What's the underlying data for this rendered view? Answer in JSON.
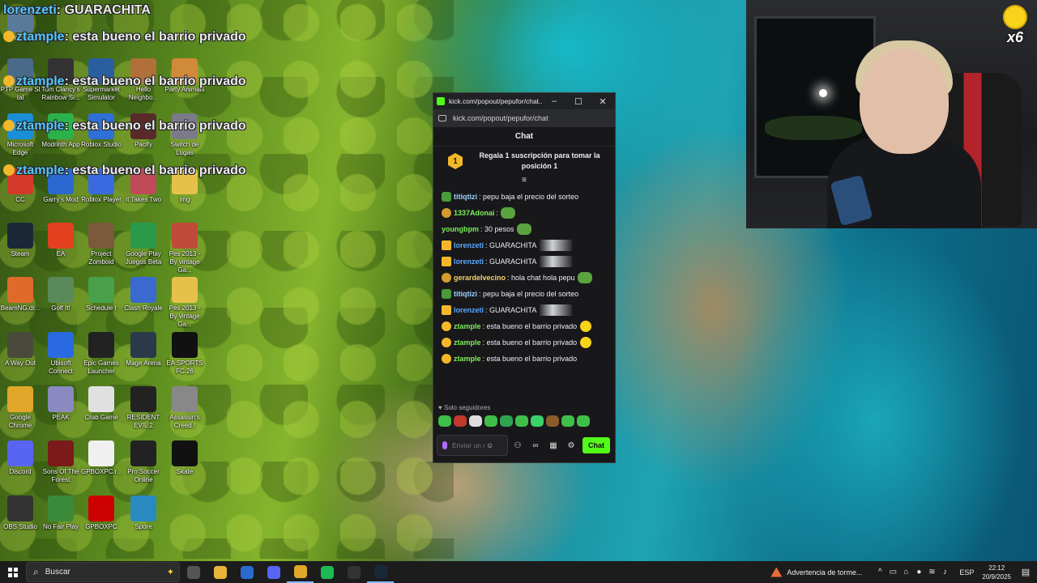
{
  "overlay": {
    "top_name": "lorenzeti",
    "top_text": "GUARACHITA",
    "lines": [
      {
        "user": "ztample",
        "text": "esta bueno el barrio privado"
      },
      {
        "user": "ztample",
        "text": "esta bueno el barrio privado"
      },
      {
        "user": "ztample",
        "text": "esta bueno el barrio privado"
      },
      {
        "user": "ztample",
        "text": "esta bueno el barrio privado"
      }
    ]
  },
  "desktop_icons": [
    {
      "label": "reciclaje",
      "color": "#5a7a9a"
    },
    {
      "label": "PTP Game Sl tal",
      "color": "#4a6a8a"
    },
    {
      "label": "Tom Clancy's Rainbow Si...",
      "color": "#333"
    },
    {
      "label": "Supermarket Simulator",
      "color": "#2a5ea0"
    },
    {
      "label": "Hello Neighbo...",
      "color": "#b0703a"
    },
    {
      "label": "Party Animals",
      "color": "#d08a3a"
    },
    {
      "label": "Microsoft Edge",
      "color": "#1a8fd6"
    },
    {
      "label": "Modrinth App",
      "color": "#2bb34b"
    },
    {
      "label": "Roblox Studio",
      "color": "#2e6fd8"
    },
    {
      "label": "Pacify",
      "color": "#5a2a2a"
    },
    {
      "label": "Switch de Lugas",
      "color": "#7a7a8a"
    },
    {
      "label": "CC",
      "color": "#d43a2a"
    },
    {
      "label": "Garry's Mod",
      "color": "#2a6ad0"
    },
    {
      "label": "Roblox Player",
      "color": "#3a6ae0"
    },
    {
      "label": "It Takes Two",
      "color": "#c04a5a"
    },
    {
      "label": "img",
      "color": "#e6c14a"
    },
    {
      "label": "Steam",
      "color": "#1b2838"
    },
    {
      "label": "EA",
      "color": "#e2401f"
    },
    {
      "label": "Project Zomboid",
      "color": "#7a5a3a"
    },
    {
      "label": "Google Play Juegos Beta",
      "color": "#2a9a4a"
    },
    {
      "label": "Pes 2013 - By vintage Ga...",
      "color": "#c04a3a"
    },
    {
      "label": "BeamNG.dr...",
      "color": "#e06a2a"
    },
    {
      "label": "Golf It!",
      "color": "#5a8a5a"
    },
    {
      "label": "Schedule I",
      "color": "#4aa04a"
    },
    {
      "label": "Clash Royale",
      "color": "#3a6ad0"
    },
    {
      "label": "Pes 2013 - By vintage Ga...",
      "color": "#e6c14a"
    },
    {
      "label": "A Way Out",
      "color": "#4a4a3a"
    },
    {
      "label": "Ubisoft Connect",
      "color": "#2a6ae0"
    },
    {
      "label": "Epic Games Launcher",
      "color": "#222"
    },
    {
      "label": "Mage Arena",
      "color": "#2a3a4a"
    },
    {
      "label": "EA SPORTS FC 26",
      "color": "#111"
    },
    {
      "label": "Google Chrome",
      "color": "#e0a72a"
    },
    {
      "label": "PEAK",
      "color": "#8a8ac0"
    },
    {
      "label": "Crab Game",
      "color": "#e0e0e0"
    },
    {
      "label": "RESIDENT EVIL 2",
      "color": "#222"
    },
    {
      "label": "Assassin's Creed I",
      "color": "#888"
    },
    {
      "label": "Discord",
      "color": "#5865f2"
    },
    {
      "label": "Sons Of The Forest",
      "color": "#7a1a1a"
    },
    {
      "label": "GPBOXPC.r...",
      "color": "#f0f0f0"
    },
    {
      "label": "Pro Soccer Online",
      "color": "#222"
    },
    {
      "label": "Skate",
      "color": "#111"
    },
    {
      "label": "OBS Studio",
      "color": "#333"
    },
    {
      "label": "No Fair Play",
      "color": "#3a8a3a"
    },
    {
      "label": "GPBOXPC",
      "color": "#c00"
    },
    {
      "label": "Spore",
      "color": "#2a8ac0"
    }
  ],
  "chat_window": {
    "title": "kick.com/popout/pepufor/chat...",
    "url": "kick.com/popout/pepufor/chat",
    "header": "Chat",
    "promo_rank": "1",
    "promo_text": "Regala 1 suscripción para tomar la posición 1",
    "messages": [
      {
        "user": "titiqtizi",
        "text": ": pepu baja el precio del sorteo",
        "color": "#9bd2ff",
        "badge": "b-pepe",
        "emote": "none"
      },
      {
        "user": "1337Adonai",
        "text": ":",
        "color": "#7cf05a",
        "badge": "b-coin",
        "emote": "pepe"
      },
      {
        "user": "youngbpm",
        "text": ": 30 pesos",
        "color": "#7cf05a",
        "badge": "",
        "emote": "pepe"
      },
      {
        "user": "lorenzeti",
        "text": ": GUARACHITA",
        "color": "#5aa7ff",
        "badge": "b-crown",
        "emote": "img"
      },
      {
        "user": "lorenzeti",
        "text": ": GUARACHITA",
        "color": "#5aa7ff",
        "badge": "b-crown",
        "emote": "img"
      },
      {
        "user": "gerardelvecino",
        "text": ": hola chat hola pepu",
        "color": "#f0d36a",
        "badge": "b-coin",
        "emote": "pepe"
      },
      {
        "user": "titiqtizi",
        "text": ": pepu baja el precio del sorteo",
        "color": "#9bd2ff",
        "badge": "b-pepe",
        "emote": "none"
      },
      {
        "user": "lorenzeti",
        "text": ": GUARACHITA",
        "color": "#5aa7ff",
        "badge": "b-crown",
        "emote": "img"
      },
      {
        "user": "ztample",
        "text": ": esta bueno el barrio privado",
        "color": "#7cf05a",
        "badge": "b-gold",
        "emote": "yellow"
      },
      {
        "user": "ztample",
        "text": ": esta bueno el barrio privado",
        "color": "#7cf05a",
        "badge": "b-gold",
        "emote": "yellow"
      },
      {
        "user": "ztample",
        "text": ": esta bueno el barrio privado",
        "color": "#7cf05a",
        "badge": "b-gold",
        "emote": "none"
      }
    ],
    "followers_only": "Solo seguidores",
    "input_placeholder": "Enviar un mensaje",
    "send_label": "Chat"
  },
  "webcam": {
    "multiplier": "x6"
  },
  "taskbar": {
    "search_placeholder": "Buscar",
    "weather_alert": "Advertencia de torme...",
    "language": "ESP",
    "time": "22:12",
    "date": "20/9/2025",
    "apps": [
      {
        "name": "task-view",
        "color": "#555"
      },
      {
        "name": "file-explorer",
        "color": "#e8b43a"
      },
      {
        "name": "microsoft-store",
        "color": "#2a6ad0"
      },
      {
        "name": "discord",
        "color": "#5865f2"
      },
      {
        "name": "chrome",
        "color": "#e0a72a"
      },
      {
        "name": "spotify",
        "color": "#1db954"
      },
      {
        "name": "obs",
        "color": "#333"
      },
      {
        "name": "steam",
        "color": "#1b2838"
      }
    ]
  }
}
